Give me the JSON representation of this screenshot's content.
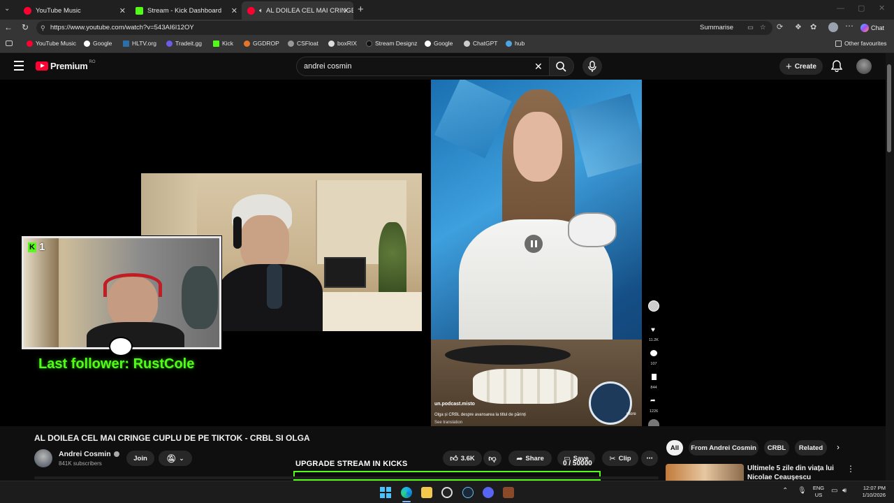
{
  "browser": {
    "tabs": [
      {
        "label": "YouTube Music",
        "favicon_color": "#ff0033"
      },
      {
        "label": "Stream - Kick Dashboard",
        "favicon_color": "#53fc18"
      },
      {
        "label": "AL DOILEA CEL MAI CRINGE C",
        "favicon_color": "#ff0033"
      }
    ],
    "url": "https://www.youtube.com/watch?v=543AI6I12OY",
    "summarise_label": "Summarise",
    "chat_label": "Chat",
    "bookmarks": [
      {
        "label": "YouTube Music",
        "color": "#ff0033"
      },
      {
        "label": "Google",
        "color": "#ffffff"
      },
      {
        "label": "HLTV.org",
        "color": "#2b6ea8"
      },
      {
        "label": "Tradeit.gg",
        "color": "#6c5ce7"
      },
      {
        "label": "Kick",
        "color": "#53fc18"
      },
      {
        "label": "GGDROP",
        "color": "#e8742a"
      },
      {
        "label": "CSFloat",
        "color": "#999999"
      },
      {
        "label": "boxRIX",
        "color": "#dddddd"
      },
      {
        "label": "Stream Designz",
        "color": "#111111"
      },
      {
        "label": "Google",
        "color": "#ffffff"
      },
      {
        "label": "ChatGPT",
        "color": "#cccccc"
      },
      {
        "label": "hub",
        "color": "#4fa3e0"
      }
    ],
    "other_favourites": "Other favourites"
  },
  "youtube": {
    "logo_text": "Premium",
    "region": "RO",
    "search_value": "andrei cosmin",
    "create_label": "Create"
  },
  "stream_overlay": {
    "kick_count": "1",
    "last_follower": "Last follower: RustCole",
    "upgrade_text": "UPGRADE STREAM IN KICKS",
    "kicks_progress": "0 / 50000",
    "progress_fraction": 0,
    "accent_color": "#53fc18"
  },
  "tiktok": {
    "likes": "11.2K",
    "comments": "107",
    "saves": "844",
    "shares": "1226",
    "handle": "un.podcast.misto",
    "caption": "Olga și CRBL despre avansarea la titlul de părinți",
    "see_translation": "See translation",
    "more": "more"
  },
  "video": {
    "title": "AL DOILEA CEL MAI CRINGE CUPLU DE PE TIKTOK - CRBL SI OLGA",
    "channel": "Andrei Cosmin",
    "subscribers": "841K subscribers",
    "join_label": "Join",
    "likes": "3.6K",
    "share_label": "Share",
    "save_label": "Save",
    "clip_label": "Clip"
  },
  "chips": [
    "All",
    "From Andrei Cosmin",
    "CRBL",
    "Related"
  ],
  "recommendation": {
    "title": "Ultimele 5 zile din viața lui",
    "title2": "Nicolae Ceaușescu"
  },
  "system": {
    "lang1": "ENG",
    "lang2": "US",
    "time": "12:07 PM",
    "date": "1/10/2026"
  }
}
